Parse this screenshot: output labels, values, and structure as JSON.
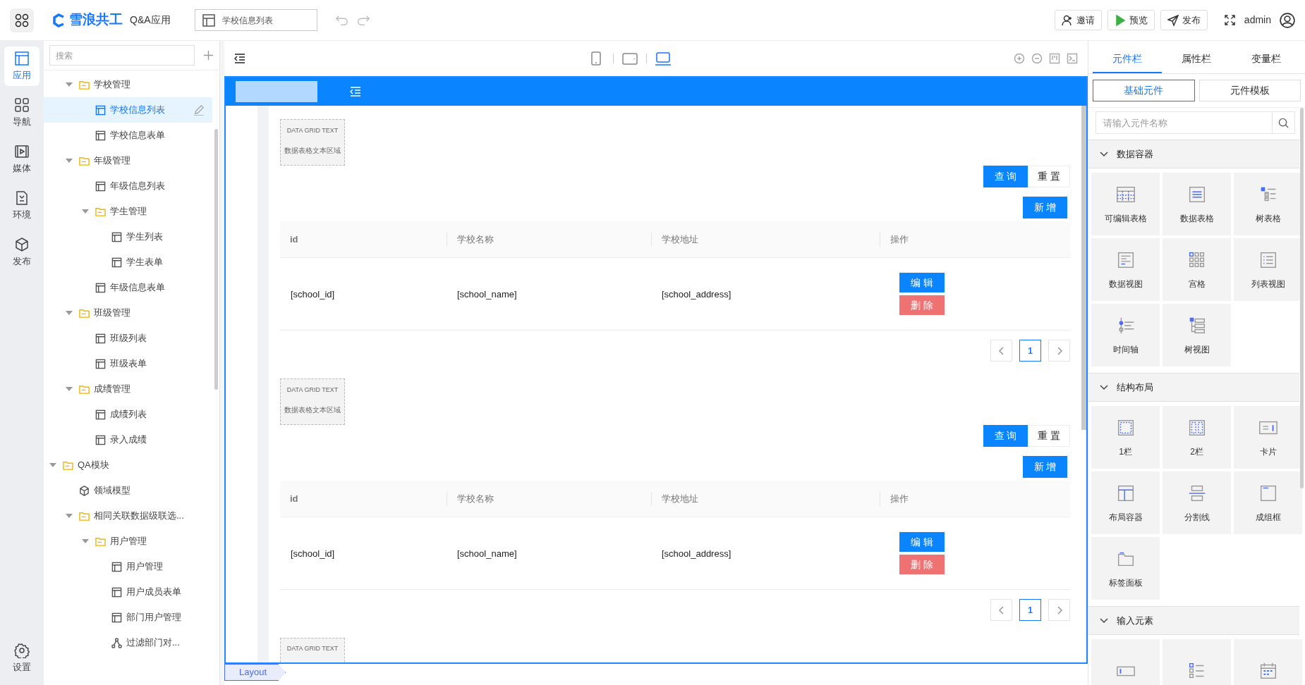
{
  "header": {
    "brand": "雪浪共工",
    "app_name": "Q&A应用",
    "page_select": "学校信息列表",
    "buttons": [
      {
        "kind": "invite",
        "label": "邀请"
      },
      {
        "kind": "preview",
        "label": "预览"
      },
      {
        "kind": "publish",
        "label": "发布"
      }
    ],
    "user": "admin"
  },
  "rail": {
    "items": [
      {
        "kind": "app",
        "label": "应用",
        "selected": true
      },
      {
        "kind": "nav",
        "label": "导航",
        "selected": false
      },
      {
        "kind": "media",
        "label": "媒体",
        "selected": false
      },
      {
        "kind": "env",
        "label": "环境",
        "selected": false
      },
      {
        "kind": "publish",
        "label": "发布",
        "selected": false
      }
    ],
    "bottom": {
      "kind": "settings",
      "label": "设置",
      "selected": false
    }
  },
  "tree": {
    "search_placeholder": "搜索",
    "items": [
      {
        "children": [
          {
            "kind": "folder",
            "label": "学校管理",
            "expanded": true,
            "selected": false,
            "children": [
              {
                "kind": "page",
                "label": "学校信息列表",
                "selected": true
              },
              {
                "kind": "page",
                "label": "学校信息表单",
                "selected": false
              }
            ]
          },
          {
            "kind": "folder",
            "label": "年级管理",
            "expanded": true,
            "selected": false,
            "children": [
              {
                "kind": "page",
                "label": "年级信息列表",
                "selected": false
              },
              {
                "kind": "folder",
                "label": "学生管理",
                "expanded": true,
                "selected": false,
                "children": [
                  {
                    "kind": "page",
                    "label": "学生列表",
                    "selected": false
                  },
                  {
                    "kind": "page",
                    "label": "学生表单",
                    "selected": false
                  }
                ]
              },
              {
                "kind": "page",
                "label": "年级信息表单",
                "selected": false
              }
            ]
          },
          {
            "kind": "folder",
            "label": "班级管理",
            "expanded": true,
            "selected": false,
            "children": [
              {
                "kind": "page",
                "label": "班级列表",
                "selected": false
              },
              {
                "kind": "page",
                "label": "班级表单",
                "selected": false
              }
            ]
          },
          {
            "kind": "folder",
            "label": "成绩管理",
            "expanded": true,
            "selected": false,
            "children": [
              {
                "kind": "page",
                "label": "成绩列表",
                "selected": false
              },
              {
                "kind": "page",
                "label": "录入成绩",
                "selected": false
              }
            ]
          }
        ]
      },
      {
        "kind": "folder",
        "label": "QA模块",
        "expanded": true,
        "selected": false,
        "children": [
          {
            "kind": "model",
            "label": "领域模型",
            "selected": false
          },
          {
            "kind": "folder",
            "label": "相同关联数据级联选...",
            "expanded": true,
            "selected": false,
            "children": [
              {
                "kind": "folder",
                "label": "用户管理",
                "expanded": true,
                "selected": false,
                "children": [
                  {
                    "kind": "page",
                    "label": "用户管理",
                    "selected": false
                  },
                  {
                    "kind": "page",
                    "label": "用户成员表单",
                    "selected": false
                  },
                  {
                    "kind": "page",
                    "label": "部门用户管理",
                    "selected": false
                  },
                  {
                    "kind": "filter",
                    "label": "过滤部门对...",
                    "selected": false
                  }
                ]
              }
            ]
          }
        ]
      }
    ]
  },
  "canvas": {
    "devices": [
      {
        "kind": "phone",
        "selected": false
      },
      {
        "kind": "tablet",
        "selected": false
      },
      {
        "kind": "desktop",
        "selected": true
      }
    ],
    "blocks": [
      {
        "grid_text": "DATA GRID TEXT",
        "grid_subtext": "数据表格文本区域",
        "query": "查 询",
        "reset": "重 置",
        "add": "新 增",
        "columns": [
          "id",
          "学校名称",
          "学校地址",
          "操作"
        ],
        "row": [
          "[school_id]",
          "[school_name]",
          "[school_address]"
        ],
        "edit": "编 辑",
        "delete": "删 除",
        "page": "1"
      },
      {
        "grid_text": "DATA GRID TEXT",
        "grid_subtext": "数据表格文本区域",
        "query": "查 询",
        "reset": "重 置",
        "add": "新 增",
        "columns": [
          "id",
          "学校名称",
          "学校地址",
          "操作"
        ],
        "row": [
          "[school_id]",
          "[school_name]",
          "[school_address]"
        ],
        "edit": "编 辑",
        "delete": "删 除",
        "page": "1"
      },
      {
        "grid_text": "DATA GRID TEXT"
      }
    ],
    "breadcrumb": "Layout"
  },
  "panel": {
    "tabs": [
      {
        "label": "元件栏",
        "selected": true
      },
      {
        "label": "属性栏",
        "selected": false
      },
      {
        "label": "变量栏",
        "selected": false
      }
    ],
    "subtabs": [
      {
        "label": "基础元件",
        "selected": true
      },
      {
        "label": "元件模板",
        "selected": false
      }
    ],
    "search_placeholder": "请输入元件名称",
    "sections": [
      {
        "title": "数据容器",
        "expanded": true,
        "items": [
          {
            "kind": "edit-table",
            "label": "可编辑表格"
          },
          {
            "kind": "table",
            "label": "数据表格"
          },
          {
            "kind": "tree-table",
            "label": "树表格"
          },
          {
            "kind": "data-view",
            "label": "数据视图"
          },
          {
            "kind": "grid",
            "label": "宫格"
          },
          {
            "kind": "list",
            "label": "列表视图"
          },
          {
            "kind": "timeline",
            "label": "时间轴"
          },
          {
            "kind": "tree",
            "label": "树视图"
          }
        ]
      },
      {
        "title": "结构布局",
        "expanded": true,
        "items": [
          {
            "kind": "col1",
            "label": "1栏"
          },
          {
            "kind": "col2",
            "label": "2栏"
          },
          {
            "kind": "card",
            "label": "卡片"
          },
          {
            "kind": "layout",
            "label": "布局容器"
          },
          {
            "kind": "divider",
            "label": "分割线"
          },
          {
            "kind": "group",
            "label": "成组框"
          },
          {
            "kind": "tabs",
            "label": "标签面板"
          }
        ]
      },
      {
        "title": "输入元素",
        "expanded": true,
        "items": [
          {
            "kind": "input"
          },
          {
            "kind": "checkbox"
          },
          {
            "kind": "date"
          }
        ]
      }
    ]
  }
}
